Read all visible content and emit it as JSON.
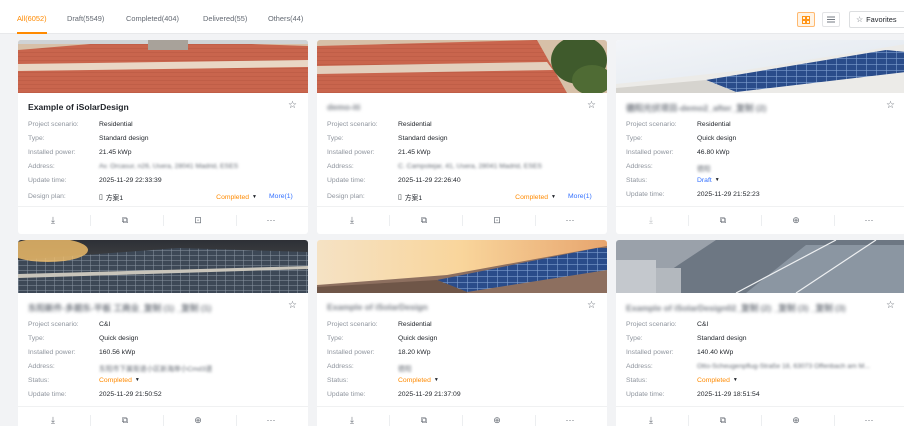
{
  "tabs": [
    {
      "label": "All(6052)",
      "active": true
    },
    {
      "label": "Draft(5549)",
      "active": false
    },
    {
      "label": "Completed(404)",
      "active": false
    },
    {
      "label": "Delivered(55)",
      "active": false
    },
    {
      "label": "Others(44)",
      "active": false
    }
  ],
  "toolbar": {
    "favorites_label": "Favorites"
  },
  "labels": {
    "scenario": "Project scenario:",
    "type": "Type:",
    "power": "Installed power:",
    "address": "Address:",
    "update": "Update time:",
    "design_plan": "Design plan:",
    "status": "Status:"
  },
  "colors": {
    "accent": "#ff8a00",
    "link": "#3370ff"
  },
  "cards": [
    {
      "title": "Example of iSolarDesign",
      "title_blurred": false,
      "scenario": "Residential",
      "type": "Standard design",
      "power": "21.45 kWp",
      "address": "Av. Orcasur, n26, Usera, 28041 Madrid, ESES",
      "update_time": "2025-11-29 22:33:39",
      "plan_name": "方案1",
      "plan_status": "Completed",
      "more": "More(1)"
    },
    {
      "title": "demo-iti",
      "title_blurred": true,
      "scenario": "Residential",
      "type": "Standard design",
      "power": "21.45 kWp",
      "address": "C. Campotejar, 41, Usera, 28041 Madrid, ESES",
      "update_time": "2025-11-29 22:26:40",
      "plan_name": "方案1",
      "plan_status": "Completed",
      "more": "More(1)"
    },
    {
      "title": "德阳光伏项目-demo2_after_复制 (2)",
      "title_blurred": true,
      "scenario": "Residential",
      "type": "Quick design",
      "power": "46.80 kWp",
      "address": "德阳",
      "status": "Draft",
      "update_time": "2025-11-29 21:52:23"
    },
    {
      "title": "东阳新件-多期东-平板 工商业_复制 (1) _复制 (1)",
      "title_blurred": true,
      "scenario": "C&I",
      "type": "Quick design",
      "power": "160.56 kWp",
      "address": "东阳市下属街道小区新海岸小Cmd3道",
      "status": "Completed",
      "update_time": "2025-11-29 21:50:52"
    },
    {
      "title": "Example of iSolarDesign",
      "title_blurred": true,
      "scenario": "Residential",
      "type": "Quick design",
      "power": "18.20 kWp",
      "address": "德阳",
      "status": "Completed",
      "update_time": "2025-11-29 21:37:09"
    },
    {
      "title": "Example of iSolarDesign02_复制 (2) _复制 (3) _复制 (3)",
      "title_blurred": true,
      "scenario": "C&I",
      "type": "Standard design",
      "power": "140.40 kWp",
      "address": "Otto-Scheugenpflug-Straße 18, 63073 Offenbach am M...",
      "status": "Completed",
      "update_time": "2025-11-29 18:51:54"
    }
  ],
  "actions": [
    "download-icon",
    "copy-icon",
    "compare-icon",
    "more-icon"
  ]
}
